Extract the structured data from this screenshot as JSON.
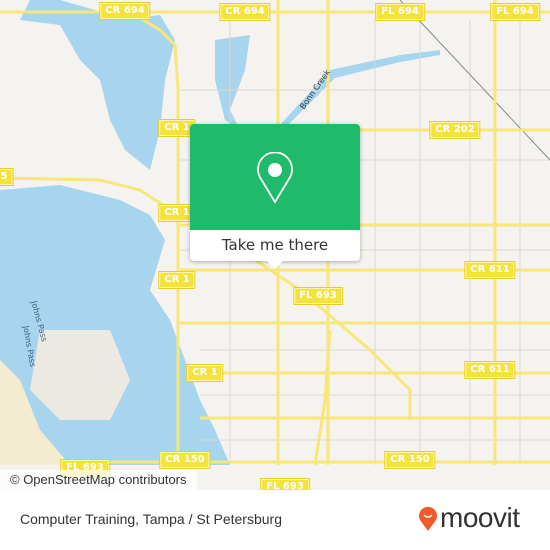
{
  "map": {
    "road_labels": [
      "CR 694",
      "CR 694",
      "FL 694",
      "FL 694",
      "CR 1",
      "CR 1",
      "CR 1",
      "CR 1",
      "CR 202",
      "CR 611",
      "CR 611",
      "FL 693",
      "CR 150",
      "CR 150",
      "FL 693",
      "FL 693",
      "5"
    ],
    "water_labels": [
      "Johns Pass",
      "Johns Pass"
    ],
    "creek_label": "Bonn Creek",
    "attribution": "© OpenStreetMap contributors",
    "colors": {
      "land": "#f4f3ef",
      "water": "#a8d5ee",
      "road": "#f7e67a",
      "accent": "#1fba6a"
    }
  },
  "popup": {
    "icon": "map-pin-icon",
    "button_label": "Take me there"
  },
  "footer": {
    "place": "Computer Training, Tampa / St Petersburg",
    "brand": "moovit",
    "brand_color": "#f15a2b"
  }
}
